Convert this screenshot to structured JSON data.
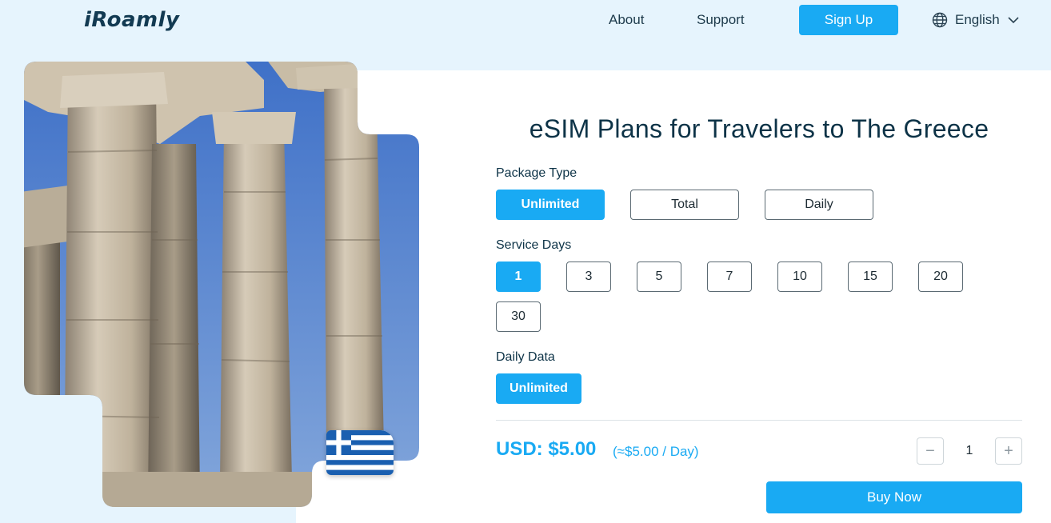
{
  "header": {
    "logo_text": "iRoamly",
    "nav": {
      "about": "About",
      "support": "Support"
    },
    "signup_label": "Sign Up",
    "language": {
      "label": "English",
      "icon": "globe-icon",
      "chevron": "chevron-down-icon"
    }
  },
  "hero": {
    "image_alt_icon": "greek-temple-columns-photo",
    "flag_icon": "greece-flag-icon"
  },
  "plan": {
    "title": "eSIM Plans for Travelers to The Greece",
    "package_type": {
      "label": "Package Type",
      "options": [
        "Unlimited",
        "Total",
        "Daily"
      ],
      "selected": "Unlimited"
    },
    "service_days": {
      "label": "Service Days",
      "options": [
        "1",
        "3",
        "5",
        "7",
        "10",
        "15",
        "20",
        "30"
      ],
      "selected": "1"
    },
    "daily_data": {
      "label": "Daily Data",
      "options": [
        "Unlimited"
      ],
      "selected": "Unlimited"
    },
    "price": "USD: $5.00",
    "price_per_day": "(≈$5.00 / Day)",
    "quantity": {
      "value": "1",
      "minus": "−",
      "plus": "+"
    },
    "buy_label": "Buy Now"
  },
  "colors": {
    "accent": "#19aaf3",
    "page_background": "#e6f4fd",
    "title_text": "#0d3347"
  }
}
